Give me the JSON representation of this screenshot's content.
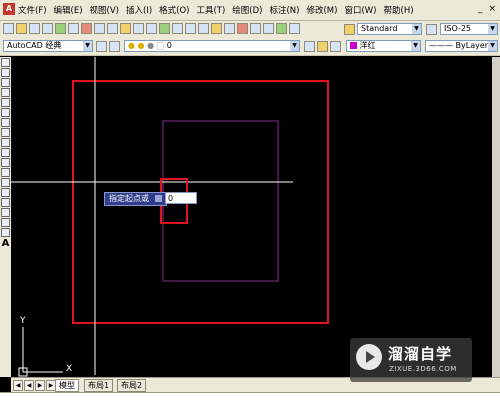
{
  "app_icon_label": "A",
  "menu": [
    "文件(F)",
    "编辑(E)",
    "视图(V)",
    "插入(I)",
    "格式(O)",
    "工具(T)",
    "绘图(D)",
    "标注(N)",
    "修改(M)",
    "窗口(W)",
    "帮助(H)"
  ],
  "window_controls": [
    "_",
    "×"
  ],
  "toolbar1": {
    "text_style": "Standard",
    "dim_style": "ISO-25"
  },
  "toolbar2": {
    "workspace": "AutoCAD 经典",
    "layer": "0",
    "color": "洋红",
    "linetype": "ByLayer"
  },
  "dynamic_input": {
    "prompt": "指定起点或",
    "value": "0"
  },
  "ucs": {
    "y": "Y",
    "x": "X"
  },
  "layout_tabs": [
    "模型",
    "布局1",
    "布局2"
  ],
  "watermark": {
    "cn": "溜溜自学",
    "en": "ZIXUE.3D66.COM"
  },
  "colors": {
    "canvas": "#000000",
    "red_annotation": "#e0141e",
    "magenta_square": "#8a2d8f",
    "crosshair": "#ffffff"
  }
}
